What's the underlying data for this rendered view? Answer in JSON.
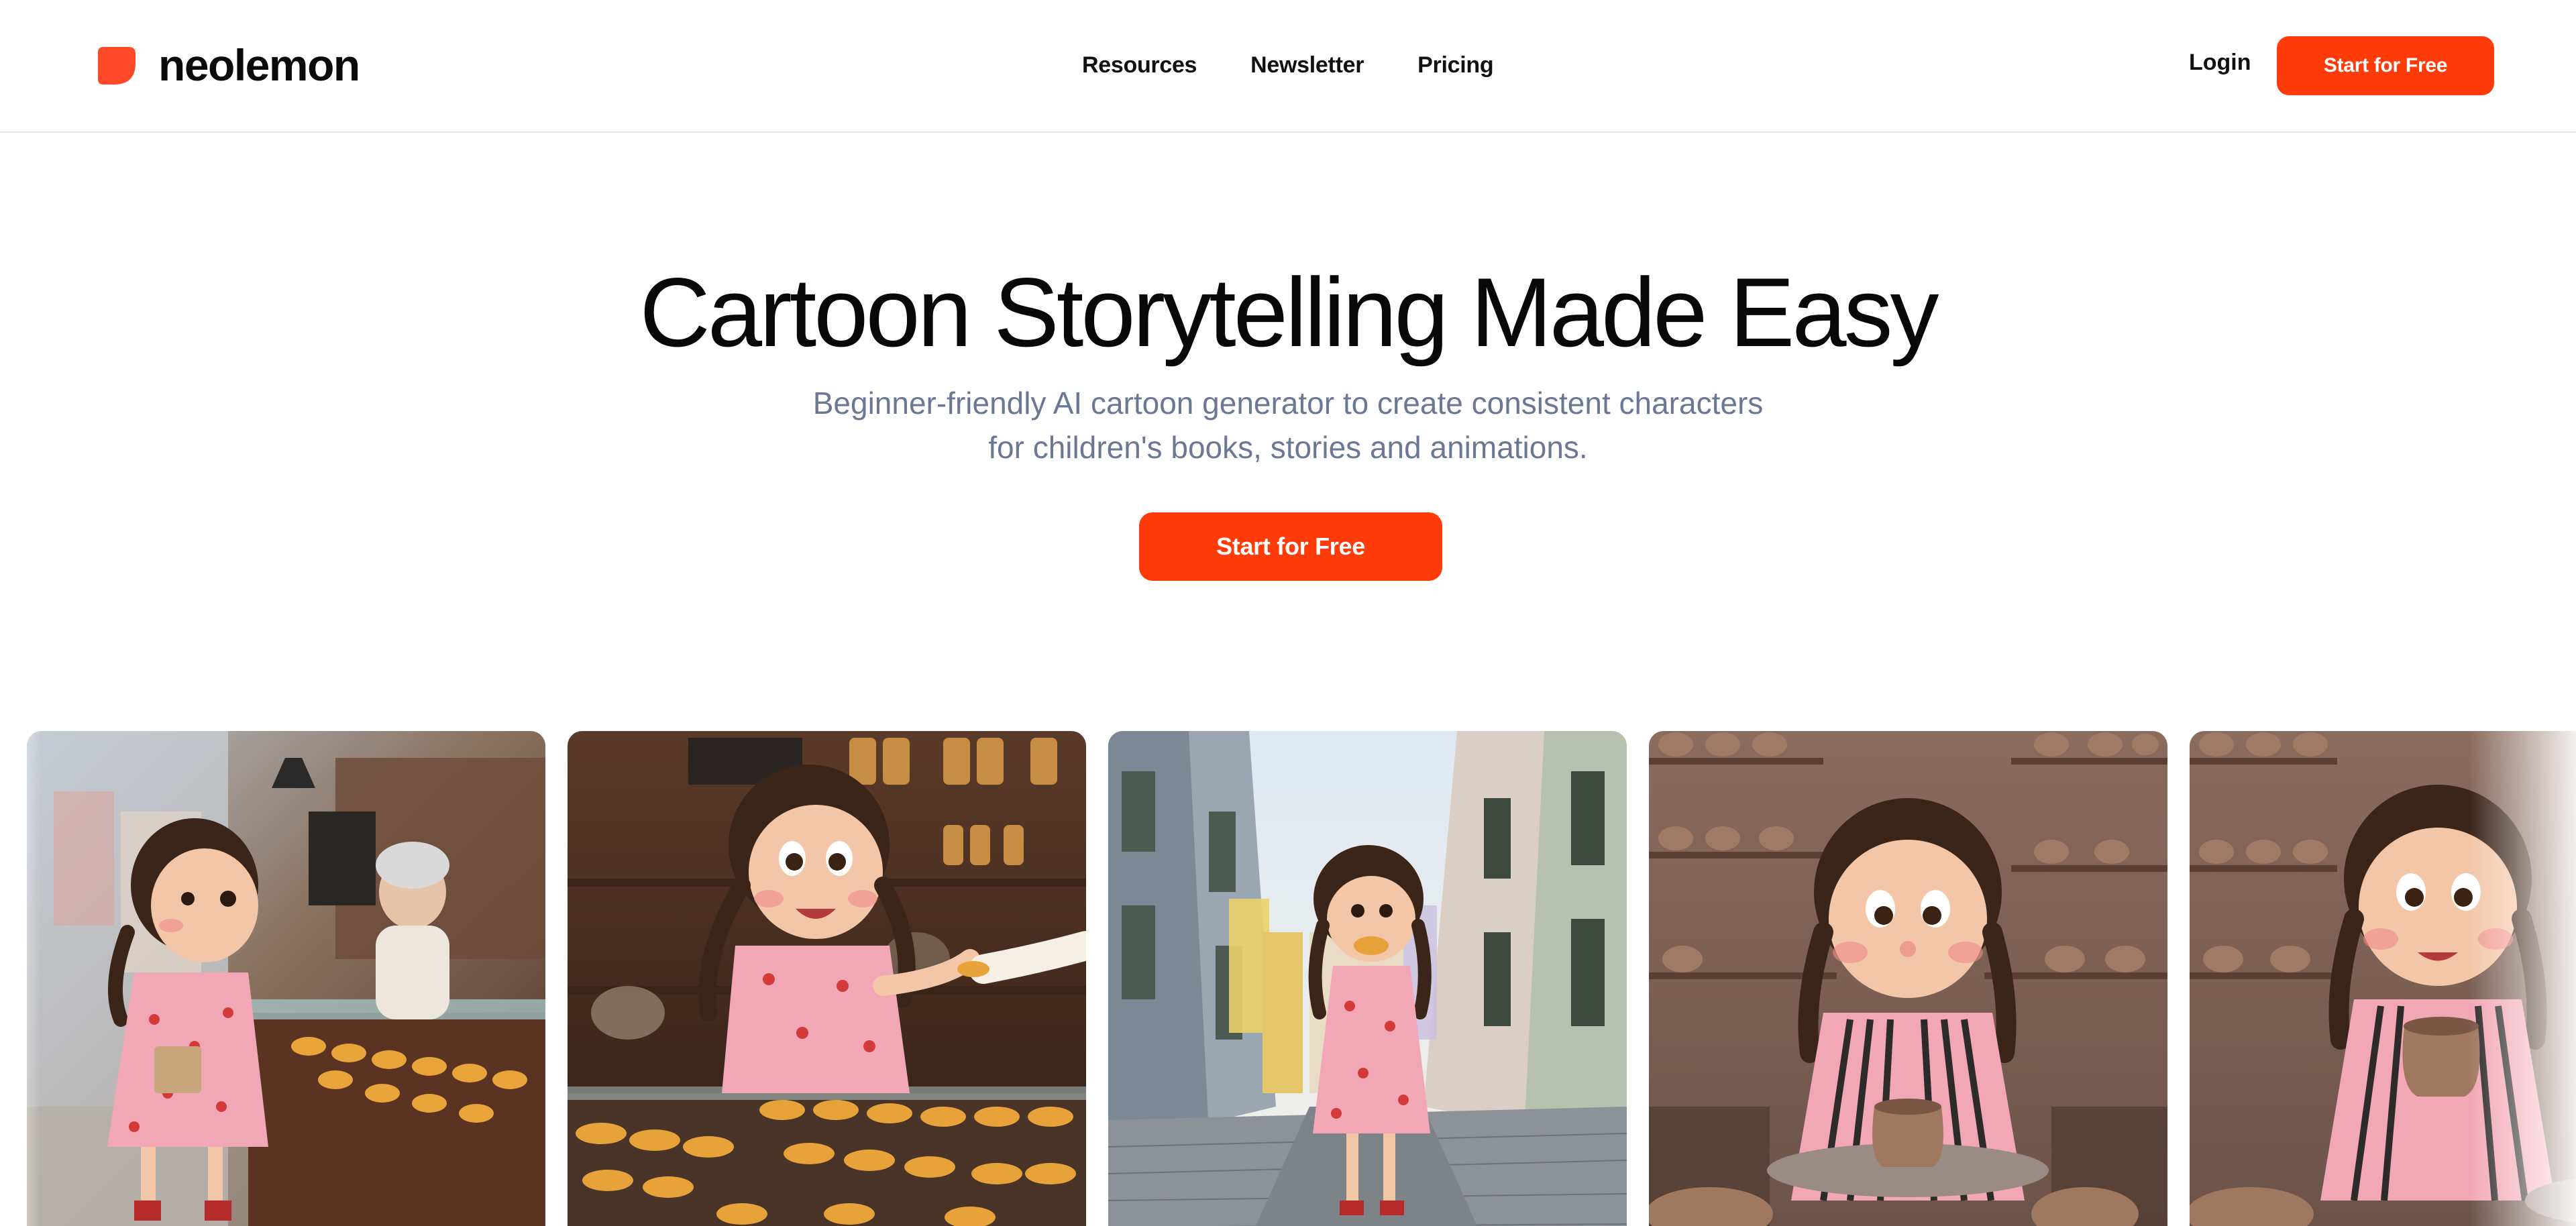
{
  "brand": {
    "name": "neolemon",
    "logo_icon": "orange-leaf-logo-icon",
    "accent_color": "#ff3b0a"
  },
  "nav": {
    "items": [
      {
        "label": "Resources"
      },
      {
        "label": "Newsletter"
      },
      {
        "label": "Pricing"
      }
    ],
    "login_label": "Login",
    "cta_label": "Start for Free"
  },
  "hero": {
    "title": "Cartoon Storytelling Made Easy",
    "subtitle_line1": "Beginner-friendly AI cartoon generator to create consistent characters",
    "subtitle_line2": "for children's books, stories and animations.",
    "cta_label": "Start for Free",
    "subtitle_color": "#6b7894"
  },
  "gallery": {
    "images": [
      {
        "name": "girl-at-bakery-counter-image",
        "scene": "bakery"
      },
      {
        "name": "girl-receiving-pastry-image",
        "scene": "bakery-closeup"
      },
      {
        "name": "girl-eating-pastry-street-image",
        "scene": "street"
      },
      {
        "name": "girl-pottery-wheel-image",
        "scene": "pottery"
      },
      {
        "name": "girl-holding-clay-pot-image",
        "scene": "pottery-closeup"
      }
    ]
  }
}
